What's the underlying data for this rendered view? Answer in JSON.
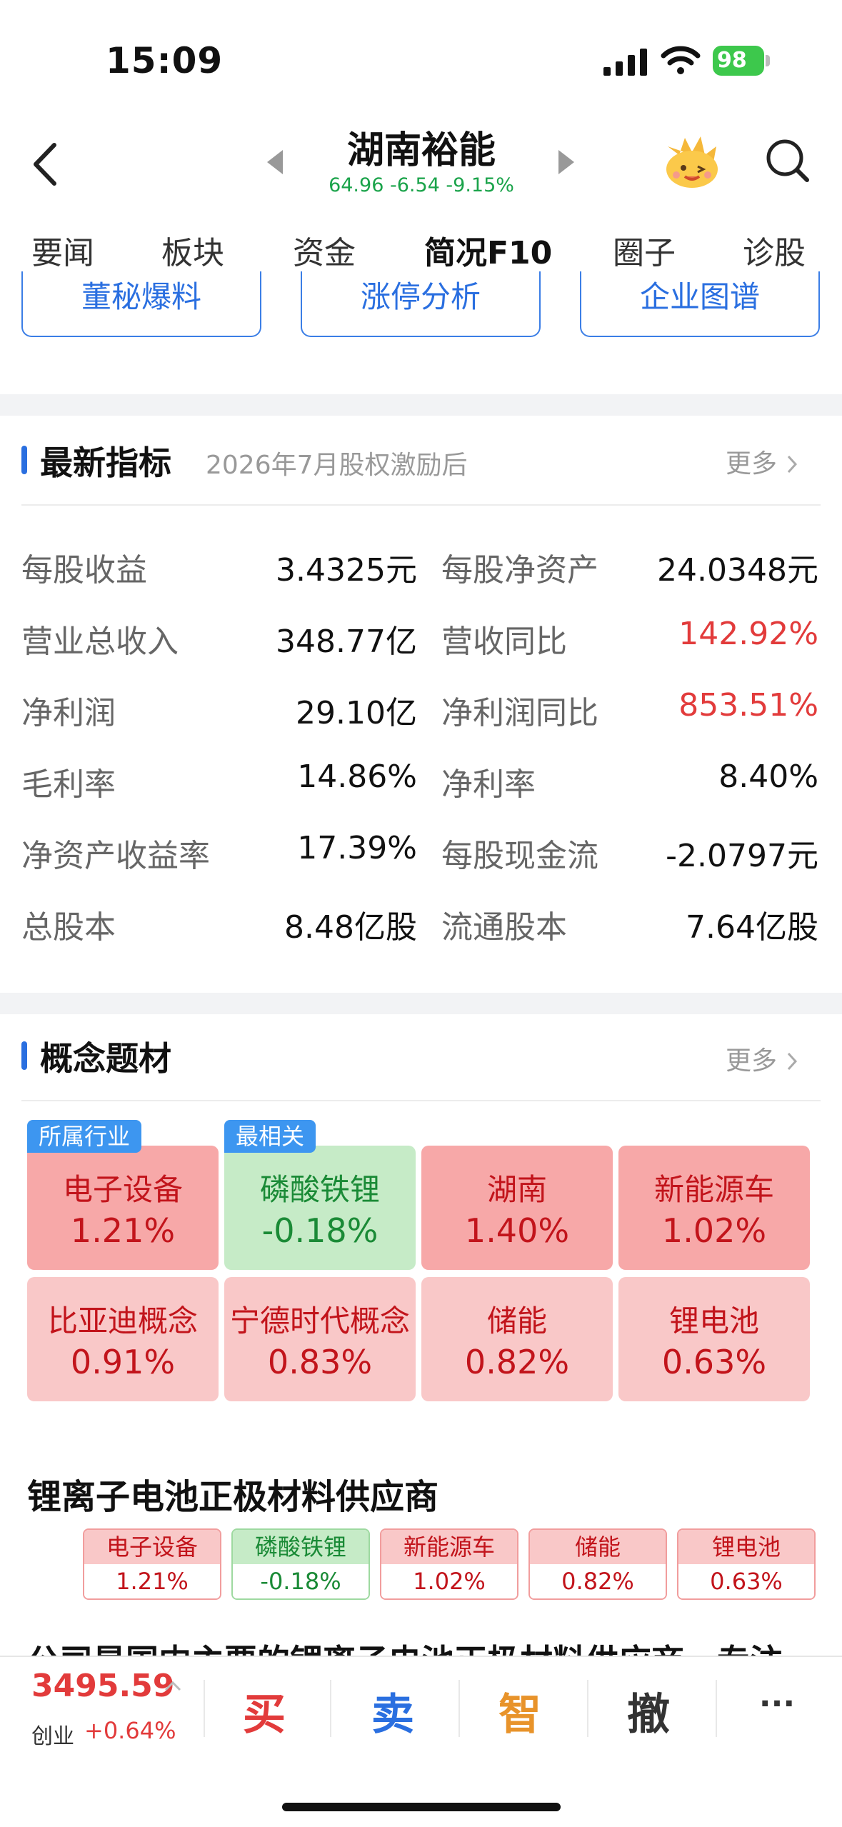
{
  "status_bar": {
    "time": "15:09",
    "battery": "98"
  },
  "header": {
    "stock_name": "湖南裕能",
    "quote": "64.96 -6.54 -9.15%"
  },
  "tabs": [
    "要闻",
    "板块",
    "资金",
    "简况F10",
    "圈子",
    "诊股"
  ],
  "active_tab": "简况F10",
  "quick_buttons": [
    "董秘爆料",
    "涨停分析",
    "企业图谱"
  ],
  "latest_indicators": {
    "title": "最新指标",
    "subtitle": "2026年7月股权激励后",
    "more": "更多",
    "rows": [
      [
        {
          "label": "每股收益",
          "value": "3.4325元"
        },
        {
          "label": "每股净资产",
          "value": "24.0348元"
        }
      ],
      [
        {
          "label": "营业总收入",
          "value": "348.77亿"
        },
        {
          "label": "营收同比",
          "value": "142.92%"
        }
      ],
      [
        {
          "label": "净利润",
          "value": "29.10亿"
        },
        {
          "label": "净利润同比",
          "value": "853.51%"
        }
      ],
      [
        {
          "label": "毛利率",
          "value": "14.86%"
        },
        {
          "label": "净利率",
          "value": "8.40%"
        }
      ],
      [
        {
          "label": "净资产收益率",
          "value": "17.39%"
        },
        {
          "label": "每股现金流",
          "value": "-2.0797元"
        }
      ],
      [
        {
          "label": "总股本",
          "value": "8.48亿股"
        },
        {
          "label": "流通股本",
          "value": "7.64亿股"
        }
      ]
    ]
  },
  "concepts": {
    "title": "概念题材",
    "more": "更多",
    "tags": [
      "所属行业",
      "最相关"
    ],
    "tiles": [
      {
        "name": "电子设备",
        "pct": "1.21%"
      },
      {
        "name": "磷酸铁锂",
        "pct": "-0.18%"
      },
      {
        "name": "湖南",
        "pct": "1.40%"
      },
      {
        "name": "新能源车",
        "pct": "1.02%"
      },
      {
        "name": "比亚迪概念",
        "pct": "0.91%"
      },
      {
        "name": "宁德时代概念",
        "pct": "0.83%"
      },
      {
        "name": "储能",
        "pct": "0.82%"
      },
      {
        "name": "锂电池",
        "pct": "0.63%"
      }
    ],
    "supplier_title": "锂离子电池正极材料供应商",
    "supplier_tags": [
      {
        "name": "电子设备",
        "pct": "1.21%"
      },
      {
        "name": "磷酸铁锂",
        "pct": "-0.18%"
      },
      {
        "name": "新能源车",
        "pct": "1.02%"
      },
      {
        "name": "储能",
        "pct": "0.82%"
      },
      {
        "name": "锂电池",
        "pct": "0.63%"
      }
    ],
    "description_partial": "公司是国内主要的锂离子电池正极材料供应商，专注"
  },
  "bottom_bar": {
    "index_value": "3495.59",
    "index_name": "创业",
    "index_change": "+0.64%",
    "actions": [
      "买",
      "卖",
      "智",
      "撤",
      "···"
    ]
  },
  "colors": {
    "accent": "#2a6fe0",
    "up": "#e23b3b",
    "down": "#1aa34a"
  }
}
